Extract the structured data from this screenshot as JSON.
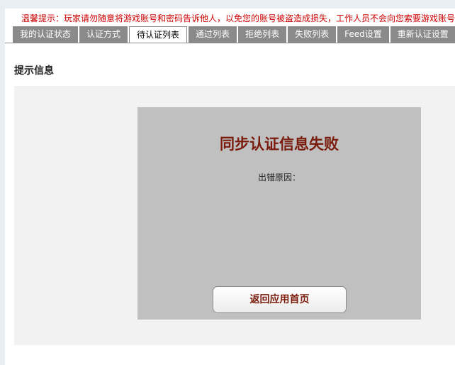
{
  "notice": "温馨提示：玩家请勿随意将游戏账号和密码告诉他人，以免您的账号被盗造成损失，工作人员不会向您索要游戏账号",
  "tabs": [
    {
      "label": "我的认证状态"
    },
    {
      "label": "认证方式"
    },
    {
      "label": "待认证列表"
    },
    {
      "label": "通过列表"
    },
    {
      "label": "拒绝列表"
    },
    {
      "label": "失败列表"
    },
    {
      "label": "Feed设置"
    },
    {
      "label": "重新认证设置"
    }
  ],
  "active_tab": "待认证列表",
  "section_title": "提示信息",
  "dialog": {
    "title": "同步认证信息失败",
    "error_reason_label": "出错原因：",
    "return_button_label": "返回应用首页"
  },
  "colors": {
    "notice_text": "#cc0000",
    "tab_bg": "#8a8a8a",
    "dialog_bg": "#c0c0c0",
    "title_text": "#7a1b0c",
    "panel_bg": "#f2f2f2"
  }
}
